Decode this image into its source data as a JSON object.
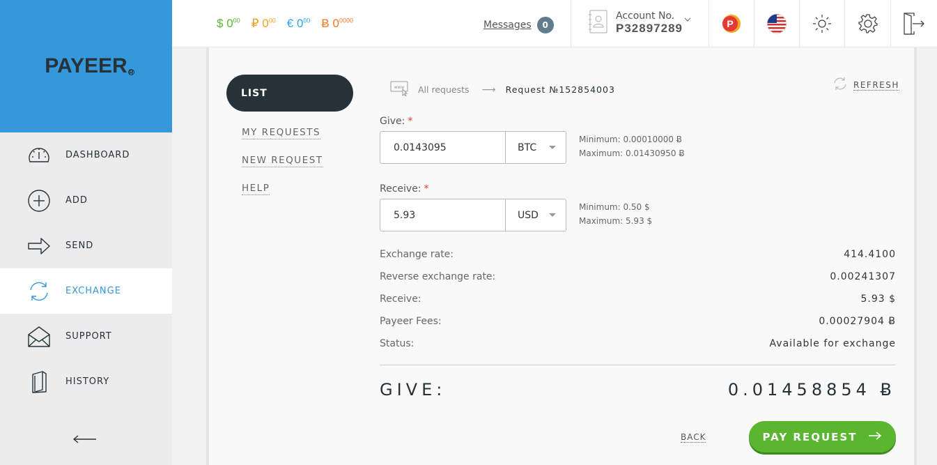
{
  "app": {
    "logo_text": "PAYEER",
    "logo_reg": "R"
  },
  "sidebar": {
    "items": [
      {
        "label": "DASHBOARD",
        "icon": "speedometer-icon"
      },
      {
        "label": "ADD",
        "icon": "plus-circle-icon"
      },
      {
        "label": "SEND",
        "icon": "arrow-right-icon"
      },
      {
        "label": "EXCHANGE",
        "icon": "refresh-arrows-icon",
        "active": true
      },
      {
        "label": "SUPPORT",
        "icon": "envelope-icon"
      },
      {
        "label": "HISTORY",
        "icon": "book-icon"
      }
    ],
    "collapse_icon": "arrow-left-icon"
  },
  "topbar": {
    "balances": [
      {
        "symbol": "$",
        "int": "0",
        "dec": "00",
        "color": "#5ab531"
      },
      {
        "symbol": "₽",
        "int": "0",
        "dec": "00",
        "color": "#f0a020"
      },
      {
        "symbol": "€",
        "int": "0",
        "dec": "00",
        "color": "#2fa4e7"
      },
      {
        "symbol": "Ƀ",
        "int": "0",
        "dec": "0000",
        "color": "#f07820"
      }
    ],
    "messages_label": "Messages",
    "messages_count": "0",
    "account_label": "Account No.",
    "account_number": "P32897289"
  },
  "side_menu": {
    "list_label": "LIST",
    "links": [
      "MY REQUESTS",
      "NEW REQUEST",
      "HELP"
    ]
  },
  "breadcrumb": {
    "all": "All requests",
    "current": "Request №152854003"
  },
  "refresh_label": "REFRESH",
  "form": {
    "give_label": "Give:",
    "give_value": "0.0143095",
    "give_currency": "BTC",
    "give_min": "Minimum: 0.00010000 Ƀ",
    "give_max": "Maximum: 0.01430950 Ƀ",
    "receive_label": "Receive:",
    "receive_value": "5.93",
    "receive_currency": "USD",
    "receive_min": "Minimum: 0.50 $",
    "receive_max": "Maximum: 5.93 $",
    "required_mark": "*"
  },
  "info": [
    {
      "key": "Exchange rate:",
      "value": "414.4100"
    },
    {
      "key": "Reverse exchange rate:",
      "value": "0.00241307"
    },
    {
      "key": "Receive:",
      "value": "5.93 $"
    },
    {
      "key": "Payeer Fees:",
      "value": "0.00027904 Ƀ"
    },
    {
      "key": "Status:",
      "value": "Available for exchange"
    }
  ],
  "total": {
    "label": "GIVE:",
    "value": "0.01458854 Ƀ"
  },
  "actions": {
    "back": "BACK",
    "pay": "PAY REQUEST"
  },
  "colors": {
    "brand_blue": "#3498db",
    "dark": "#263238",
    "green": "#5ab531"
  }
}
